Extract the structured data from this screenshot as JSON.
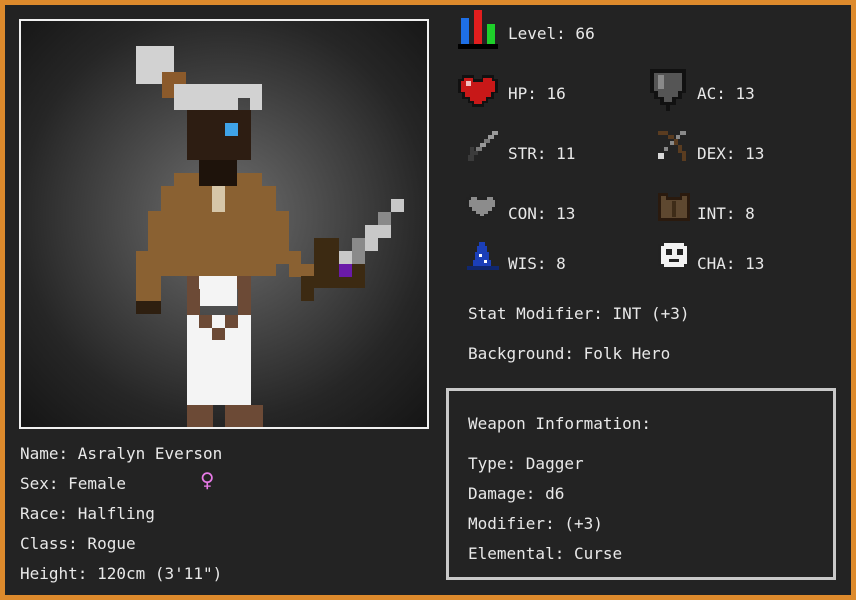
{
  "character": {
    "name_line": "Name: Asralyn Everson",
    "sex_line": "Sex: Female",
    "sex_symbol": "♀",
    "race_line": "Race: Halfling",
    "class_line": "Class: Rogue",
    "height_line": "Height: 120cm (3'11\")"
  },
  "stats": {
    "level": "Level: 66",
    "hp": "HP: 16",
    "ac": "AC: 13",
    "str": "STR: 11",
    "dex": "DEX: 13",
    "con": "CON: 13",
    "int": "INT: 8",
    "wis": "WIS: 8",
    "cha": "CHA: 13",
    "modifier": "Stat Modifier: INT (+3)",
    "background": "Background: Folk Hero"
  },
  "weapon": {
    "heading": "Weapon Information:",
    "type": "Type: Dagger",
    "damage": "Damage: d6",
    "modifier": "Modifier: (+3)",
    "elemental": "Elemental: Curse"
  },
  "icons": {
    "level": "bar-chart-icon",
    "hp": "heart-icon",
    "ac": "shield-icon",
    "str": "sword-icon",
    "dex": "bow-icon",
    "con": "gray-heart-icon",
    "int": "leather-armor-icon",
    "wis": "wizard-hat-icon",
    "cha": "mask-icon"
  },
  "colors": {
    "frame": "#dd8a2c",
    "panel": "#232323",
    "text": "#e8e8e8",
    "female_symbol": "#e77ae6"
  }
}
